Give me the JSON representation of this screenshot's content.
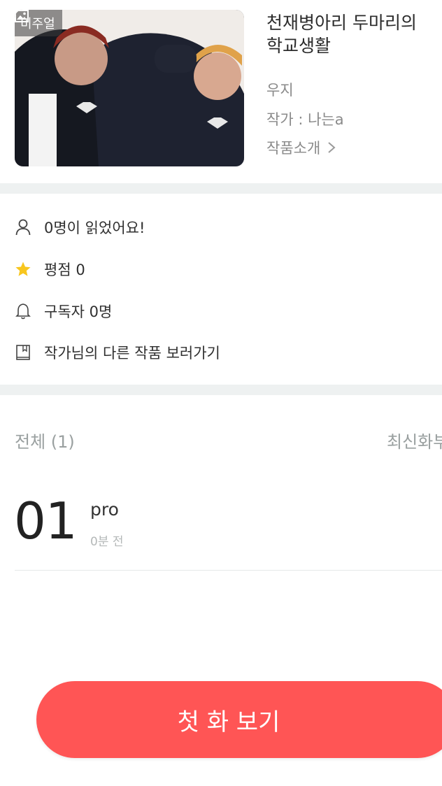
{
  "cover": {
    "badge_label": "비주얼",
    "badge_icon": "image-icon"
  },
  "work": {
    "title": "천재병아리 두마리의 학교생활",
    "genre": "우지",
    "author": "작가 : 나는a",
    "intro_label": "작품소개"
  },
  "info": {
    "readers": "0명이 읽었어요!",
    "rating": "평점 0",
    "subscribers": "구독자 0명",
    "other_works": "작가님의 다른 작품 보러가기"
  },
  "episodes": {
    "tab_all": "전체 (1)",
    "sort": "최신화부",
    "items": [
      {
        "number": "01",
        "title": "pro",
        "time": "0분 전"
      }
    ]
  },
  "cta": {
    "label": "첫 화 보기"
  },
  "colors": {
    "accent": "#ff5555",
    "star": "#f8c61e",
    "divider": "#eef1f1"
  }
}
